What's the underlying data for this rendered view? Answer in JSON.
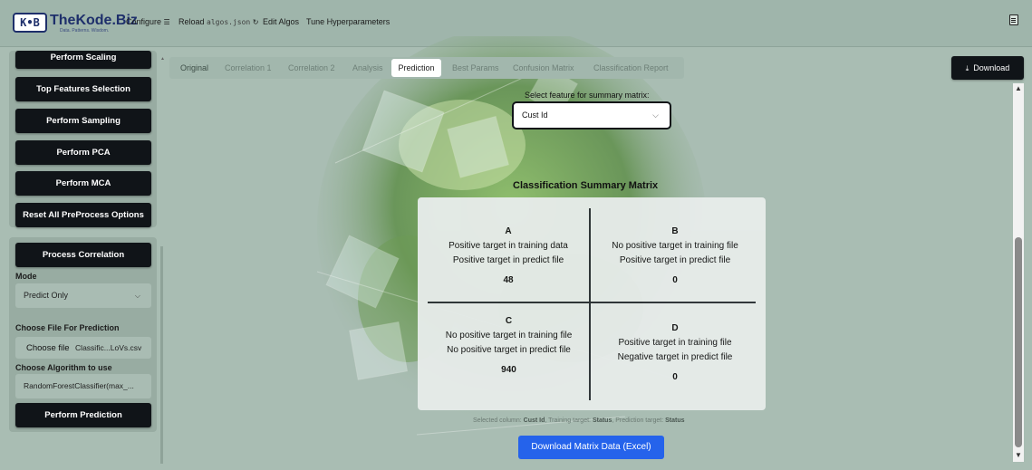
{
  "header": {
    "logo_mark": "K•B",
    "logo_name": "TheKode.Biz",
    "logo_tagline": "Data. Patterns. Wisdom.",
    "nav": {
      "configure_label": "Configure",
      "configure_icon": "sliders-icon",
      "reload_label": "Reload",
      "reload_file": "algos.json",
      "reload_icon": "refresh-icon",
      "edit_algos_label": "Edit Algos",
      "tune_label": "Tune Hyperparameters"
    },
    "doc_icon": "document-icon"
  },
  "sidebar": {
    "buttons_top": [
      "Perform Scaling",
      "Top Features Selection",
      "Perform Sampling",
      "Perform PCA",
      "Perform MCA",
      "Reset All PreProcess Options"
    ],
    "process_correlation_label": "Process Correlation",
    "mode_label": "Mode",
    "mode_value": "Predict Only",
    "choose_file_label": "Choose File For Prediction",
    "choose_file_button": "Choose file",
    "chosen_file_name": "Classific...LoVs.csv",
    "choose_algo_label": "Choose Algorithm to use",
    "algo_value": "RandomForestClassifier(max_...",
    "perform_prediction_label": "Perform Prediction"
  },
  "tabs": [
    "Original",
    "Correlation 1",
    "Correlation 2",
    "Analysis",
    "Prediction",
    "Best Params",
    "Confusion Matrix",
    "Classification Report"
  ],
  "active_tab": "Prediction",
  "download_label": "Download",
  "feature_select": {
    "label": "Select feature for summary matrix:",
    "value": "Cust Id"
  },
  "matrix": {
    "title": "Classification Summary Matrix",
    "cells": {
      "A": {
        "letter": "A",
        "line1": "Positive target in training data",
        "line2": "Positive target in predict file",
        "count": "48"
      },
      "B": {
        "letter": "B",
        "line1": "No positive target in training file",
        "line2": "Positive target in predict file",
        "count": "0"
      },
      "C": {
        "letter": "C",
        "line1": "No positive target in training file",
        "line2": "No positive target in predict file",
        "count": "940"
      },
      "D": {
        "letter": "D",
        "line1": "Positive target in training file",
        "line2": "Negative target in predict file",
        "count": "0"
      }
    }
  },
  "footnote": {
    "selected_prefix": "Selected column:",
    "selected_value": "Cust Id",
    "training_prefix": "Training target:",
    "training_value": "Status",
    "prediction_prefix": "Prediction target:",
    "prediction_value": "Status"
  },
  "download_matrix_label": "Download Matrix Data (Excel)",
  "colors": {
    "accent_blue": "#2563eb",
    "button_dark": "#101418",
    "background": "#a9bdb3"
  }
}
